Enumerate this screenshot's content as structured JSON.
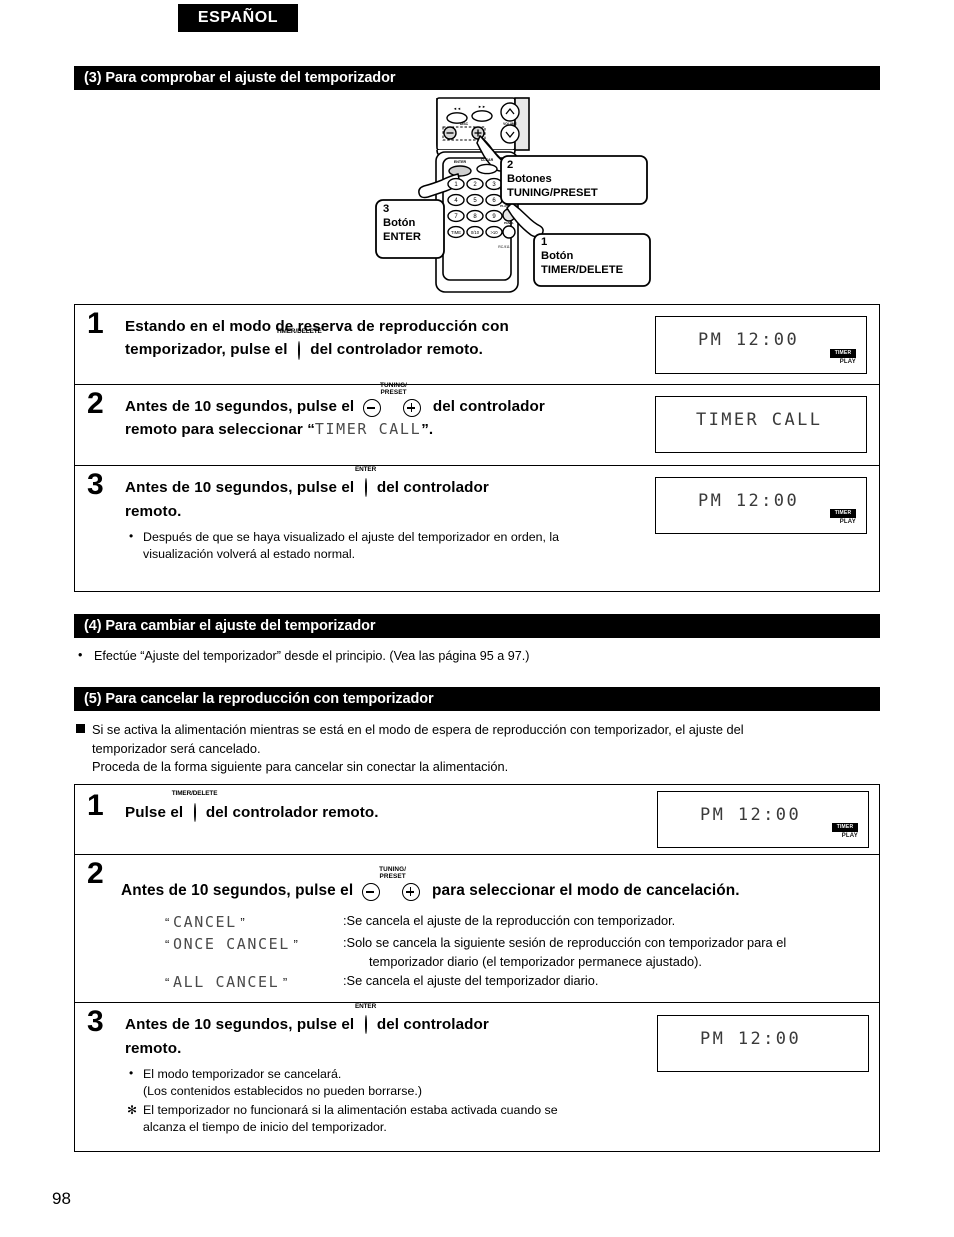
{
  "language_tab": "ESPAÑOL",
  "page_number": "98",
  "sections": {
    "s3": {
      "heading": "(3) Para comprobar el ajuste del temporizador"
    },
    "s4": {
      "heading": "(4) Para cambiar el ajuste del temporizador",
      "bullet": "Efectúe “Ajuste del temporizador” desde el principio. (Vea las página 95 a 97.)"
    },
    "s5": {
      "heading": "(5) Para cancelar la reproducción con temporizador",
      "note_line1": "Si se activa la alimentación mientras se está en el modo de espera de reproducción con temporizador, el ajuste del",
      "note_line2": "temporizador será cancelado.",
      "note_line3": "Proceda de la forma siguiente para cancelar sin conectar la alimentación."
    }
  },
  "diagram": {
    "callouts": [
      {
        "number": "2",
        "line1": "Botones",
        "line2": "TUNING/PRESET"
      },
      {
        "number": "3",
        "line1": "Botón",
        "line2": "ENTER"
      },
      {
        "number": "1",
        "line1": "Botón",
        "line2": "TIMER/DELETE"
      }
    ],
    "remote_labels": {
      "enter": "ENTER",
      "clear": "CLEAR",
      "volume": "VOLUME",
      "disc": "DISC",
      "timer_delete": "TIMER/DELETE",
      "play_mode": "PLAY MODE",
      "panel": "PANEL",
      "model": "RC-911",
      "keys": [
        "1",
        "2",
        "3",
        "4",
        "5",
        "6",
        "7",
        "8",
        "9",
        "TIME",
        "0/10",
        ">10"
      ]
    }
  },
  "check_steps": {
    "step1": {
      "number": "1",
      "text_a": "Estando en el modo de reserva de reproducción con",
      "text_b": "temporizador, pulse el",
      "icon_label": "TIMER/DELETE",
      "text_c": "del controlador remoto.",
      "lcd": {
        "text": "PM 12:00",
        "indicator_timer": "TIMER",
        "indicator_play": "PLAY"
      }
    },
    "step2": {
      "number": "2",
      "text_a": "Antes de 10 segundos, pulse el",
      "icon_label_1": "TUNING/",
      "icon_label_2": "PRESET",
      "text_b": "del controlador",
      "text_c": "remoto para seleccionar “",
      "lcd_inline": "TIMER CALL",
      "text_d": "”.",
      "lcd": {
        "text": "TIMER CALL"
      }
    },
    "step3": {
      "number": "3",
      "text_a": "Antes de 10 segundos, pulse el",
      "icon_label": "ENTER",
      "text_b": "del controlador",
      "text_c": "remoto.",
      "bullet_line1": "Después de que se haya visualizado el ajuste del temporizador en orden, la",
      "bullet_line2": "visualización volverá al estado normal.",
      "lcd": {
        "text": "PM 12:00",
        "indicator_timer": "TIMER",
        "indicator_play": "PLAY"
      }
    }
  },
  "cancel_steps": {
    "step1": {
      "number": "1",
      "text_a": "Pulse el",
      "icon_label": "TIMER/DELETE",
      "text_b": "del controlador remoto.",
      "lcd": {
        "text": "PM 12:00",
        "indicator_timer": "TIMER",
        "indicator_play": "PLAY"
      }
    },
    "step2": {
      "number": "2",
      "text_a": "Antes de 10 segundos, pulse el",
      "icon_label_1": "TUNING/",
      "icon_label_2": "PRESET",
      "text_b": "para seleccionar el modo de cancelación.",
      "options": [
        {
          "label": "CANCEL",
          "desc": ":Se cancela el ajuste de la reproducción con temporizador.",
          "desc_cont": ""
        },
        {
          "label": "ONCE CANCEL",
          "desc": ":Solo se cancela la siguiente sesión de reproducción con temporizador para el",
          "desc_cont": "temporizador diario (el temporizador permanece ajustado)."
        },
        {
          "label": "ALL CANCEL",
          "desc": ":Se cancela el ajuste del temporizador diario.",
          "desc_cont": ""
        }
      ]
    },
    "step3": {
      "number": "3",
      "text_a": "Antes de 10 segundos, pulse el",
      "icon_label": "ENTER",
      "text_b": "del controlador",
      "text_c": "remoto.",
      "bullet1_line1": "El modo temporizador se cancelará.",
      "bullet1_line2": "(Los contenidos establecidos no pueden borrarse.)",
      "bullet2_line1": "El temporizador no funcionará si la alimentación estaba activada cuando se",
      "bullet2_line2": "alcanza el tiempo de inicio del temporizador.",
      "lcd": {
        "text": "PM 12:00"
      }
    }
  }
}
